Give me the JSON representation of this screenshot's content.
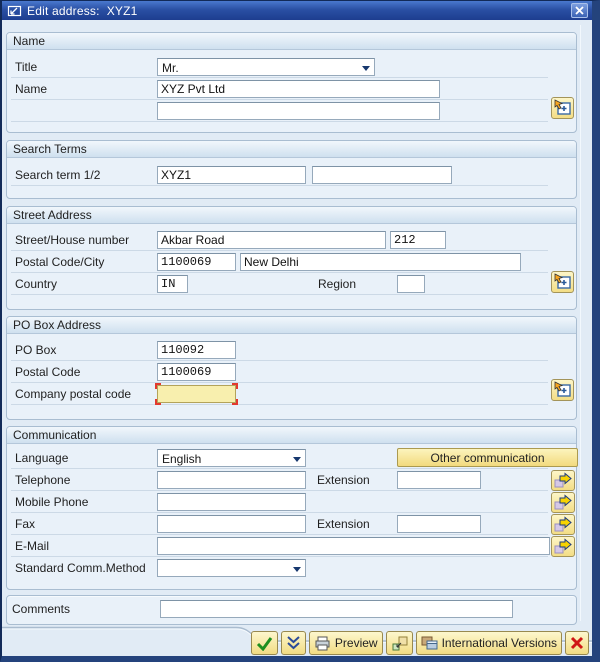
{
  "window": {
    "title": "Edit address:  XYZ1"
  },
  "sections": {
    "name": {
      "header": "Name",
      "title_label": "Title",
      "title_value": "Mr.",
      "name_label": "Name",
      "name_value": "XYZ Pvt Ltd",
      "name2_value": ""
    },
    "search": {
      "header": "Search Terms",
      "label": "Search term 1/2",
      "term1_value": "XYZ1",
      "term2_value": ""
    },
    "street": {
      "header": "Street Address",
      "street_label": "Street/House number",
      "street_value": "Akbar Road",
      "house_value": "212",
      "postal_label": "Postal Code/City",
      "postal_value": "1100069",
      "city_value": "New Delhi",
      "country_label": "Country",
      "country_value": "IN",
      "region_label": "Region",
      "region_value": ""
    },
    "pobox": {
      "header": "PO Box Address",
      "pobox_label": "PO Box",
      "pobox_value": "110092",
      "postal_label": "Postal Code",
      "postal_value": "1100069",
      "company_label": "Company postal code",
      "company_value": ""
    },
    "comm": {
      "header": "Communication",
      "language_label": "Language",
      "language_value": "English",
      "other_button_label": "Other communication",
      "telephone_label": "Telephone",
      "extension_label": "Extension",
      "telephone_value": "",
      "telephone_ext_value": "",
      "mobile_label": "Mobile Phone",
      "mobile_value": "",
      "fax_label": "Fax",
      "fax_value": "",
      "fax_ext_value": "",
      "email_label": "E-Mail",
      "email_value": "",
      "std_label": "Standard Comm.Method",
      "std_value": ""
    },
    "comments": {
      "label": "Comments",
      "value": ""
    }
  },
  "toolbar": {
    "preview_label": "Preview",
    "intl_label": "International Versions"
  },
  "icons": {
    "titlebar": "edit-window-icon",
    "close": "close-x-icon",
    "expand": "more-fields-icon",
    "comm_arrow": "arrow-right-icon",
    "continue": "green-check-icon",
    "transfer": "double-chevron-down-icon",
    "preview": "printer-icon",
    "versions": "overlapping-boxes-icon",
    "international": "stacked-windows-icon",
    "cancel": "red-x-icon"
  },
  "colors": {
    "titlebar_blue": "#2a50a4",
    "group_bg": "#e9f1f9",
    "focus_field_yellow": "#f8efae",
    "focus_corner_red": "#e2392e",
    "button_yellow": "#f2dc83"
  }
}
